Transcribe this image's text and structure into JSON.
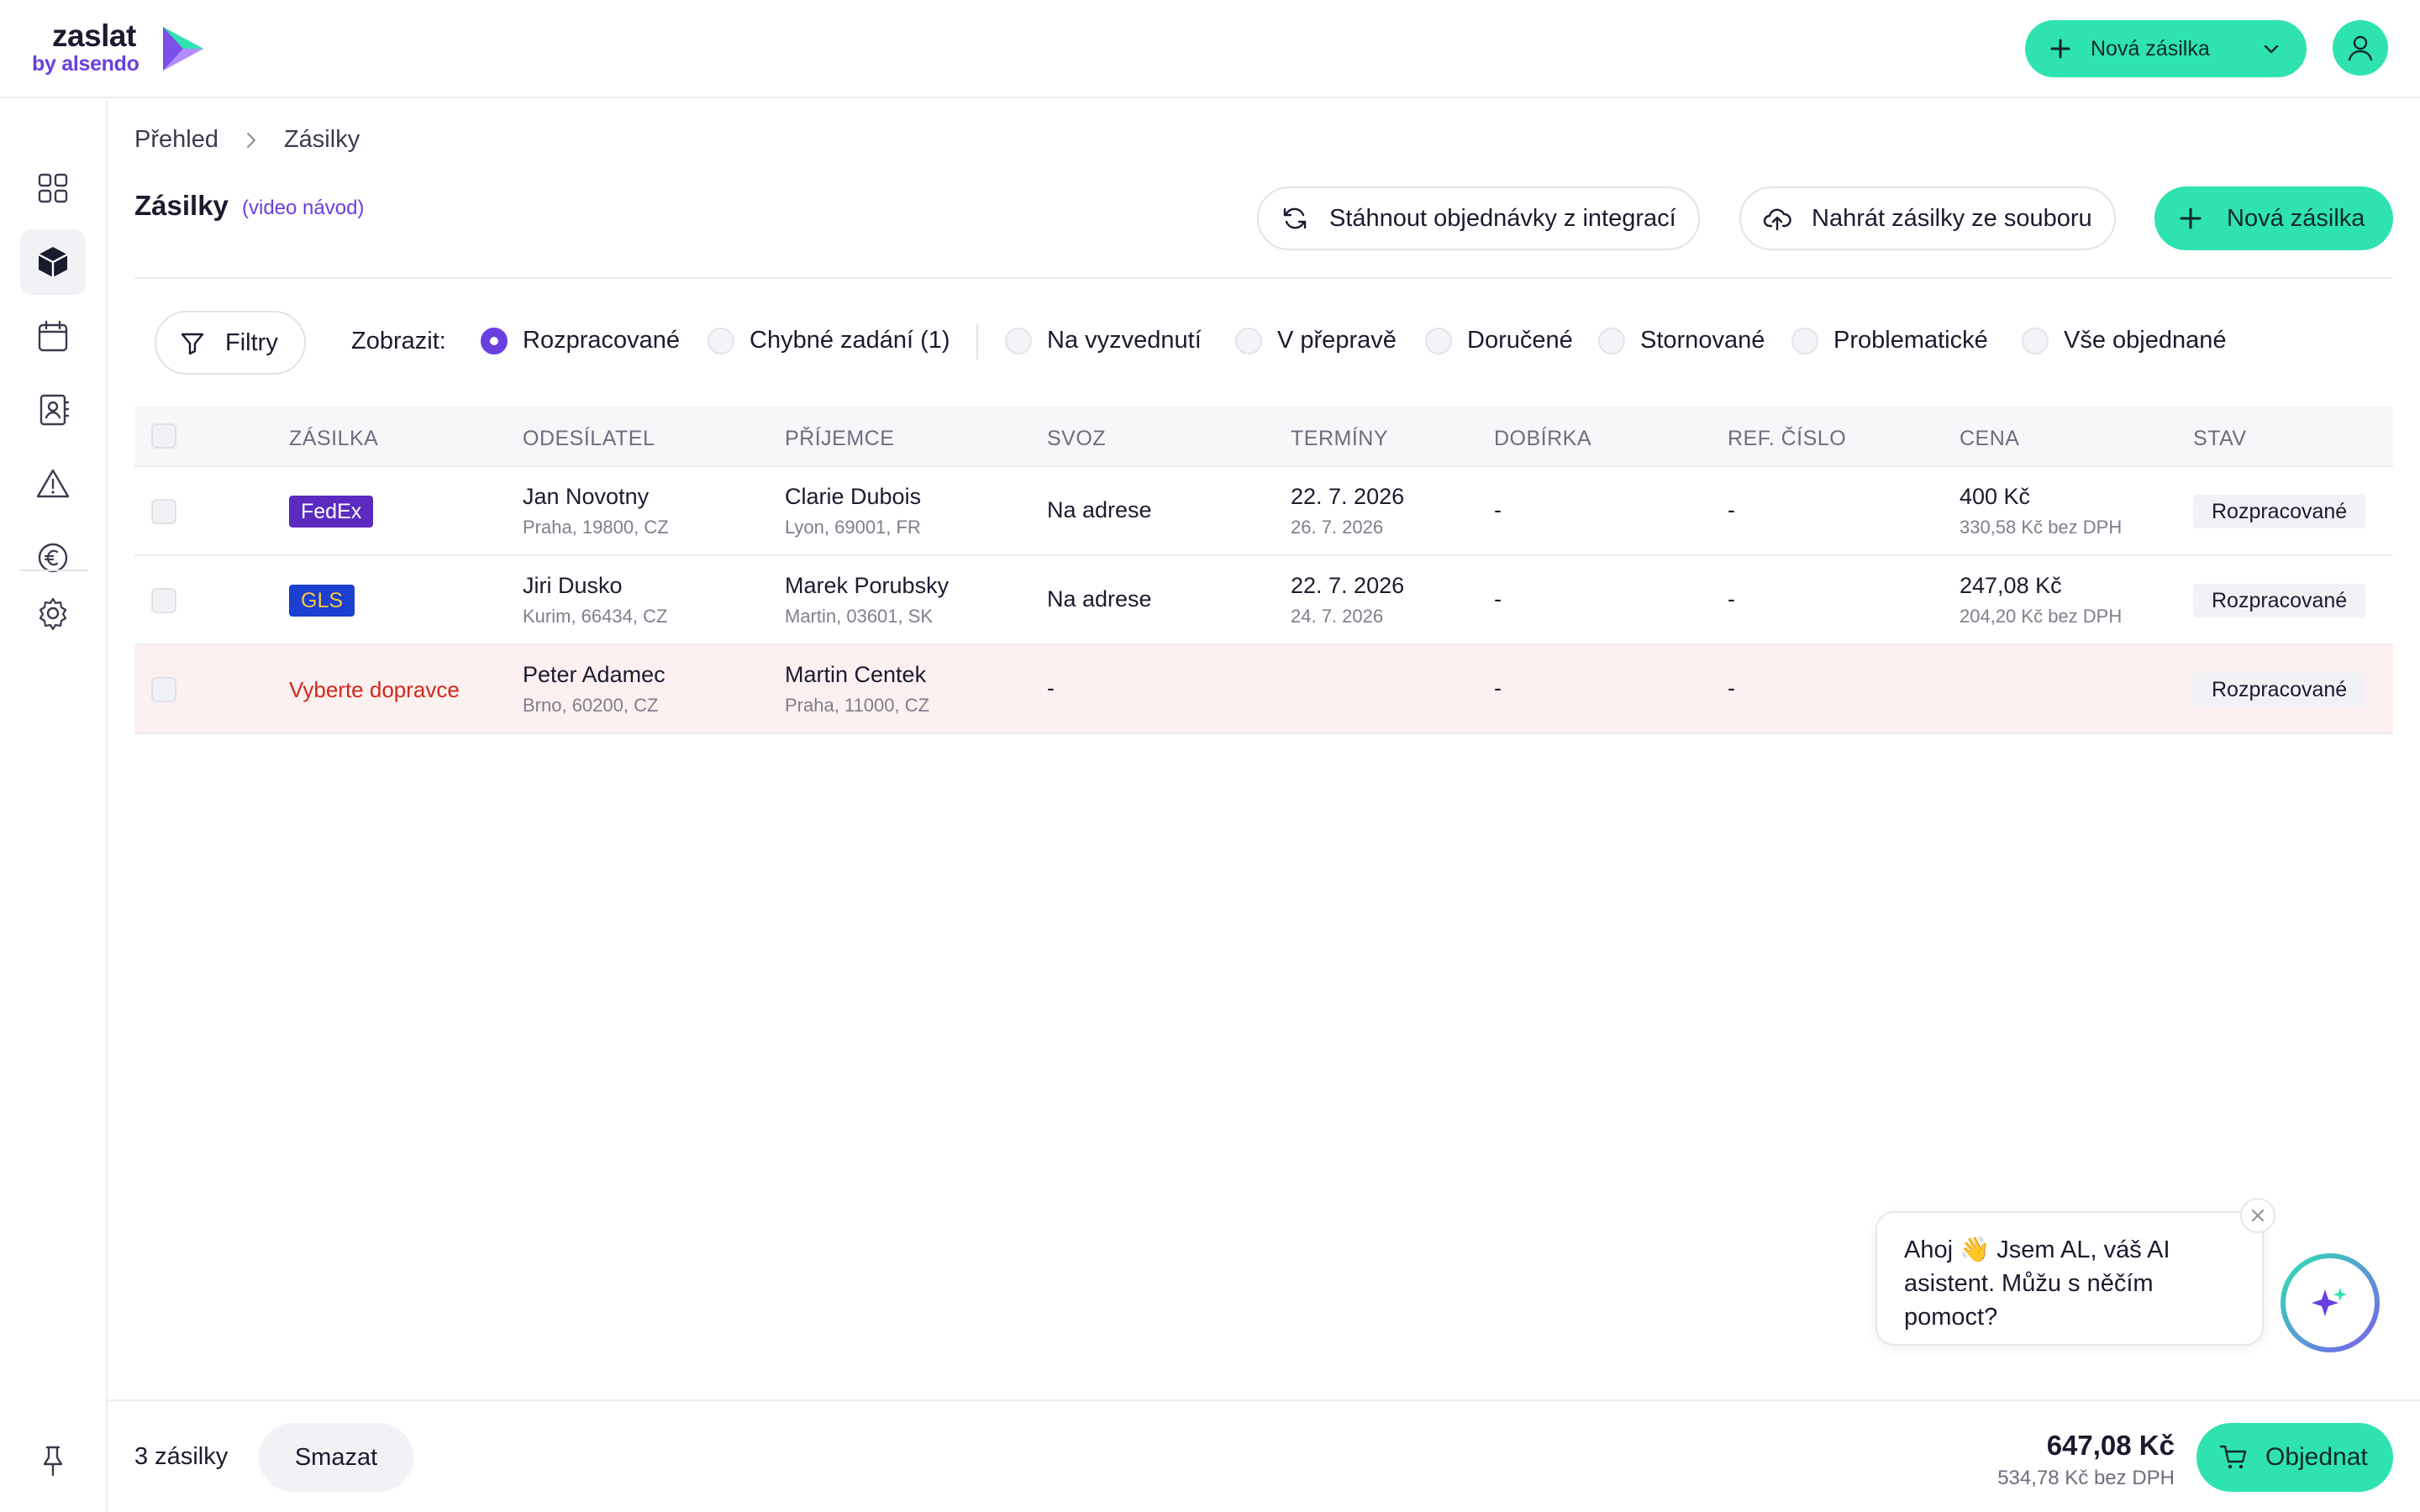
{
  "brand": {
    "name": "zaslat",
    "sub": "by alsendo"
  },
  "header": {
    "new_shipment_label": "Nová zásilka"
  },
  "sidebar": {
    "items": [
      {
        "icon": "grid-icon"
      },
      {
        "icon": "package-icon",
        "active": true
      },
      {
        "icon": "calendar-icon"
      },
      {
        "icon": "contacts-icon"
      },
      {
        "icon": "warning-icon"
      },
      {
        "icon": "euro-icon"
      },
      {
        "icon": "gear-icon"
      }
    ],
    "pin_icon": "pin-icon"
  },
  "breadcrumb": {
    "home": "Přehled",
    "current": "Zásilky"
  },
  "page": {
    "title": "Zásilky",
    "video_link": "(video návod)"
  },
  "actions": {
    "sync_label": "Stáhnout objednávky z integrací",
    "upload_label": "Nahrát zásilky ze souboru",
    "new_label": "Nová zásilka"
  },
  "filters": {
    "button_label": "Filtry",
    "show_label": "Zobrazit:",
    "options": [
      {
        "label": "Rozpracované",
        "checked": true
      },
      {
        "label": "Chybné zadání (1)",
        "checked": false
      },
      {
        "label": "Na vyzvednutí",
        "checked": false
      },
      {
        "label": "V přepravě",
        "checked": false
      },
      {
        "label": "Doručené",
        "checked": false
      },
      {
        "label": "Stornované",
        "checked": false
      },
      {
        "label": "Problematické",
        "checked": false
      },
      {
        "label": "Vše objednané",
        "checked": false
      }
    ]
  },
  "table": {
    "columns": [
      "ZÁSILKA",
      "ODESÍLATEL",
      "PŘÍJEMCE",
      "SVOZ",
      "TERMÍNY",
      "DOBÍRKA",
      "REF. ČÍSLO",
      "CENA",
      "STAV"
    ],
    "rows": [
      {
        "carrier": "FedEx",
        "sender_name": "Jan Novotny",
        "sender_addr": "Praha, 19800, CZ",
        "recipient_name": "Clarie Dubois",
        "recipient_addr": "Lyon, 69001, FR",
        "pickup": "Na adrese",
        "date1": "22. 7. 2026",
        "date2": "26. 7. 2026",
        "cod": "-",
        "ref": "-",
        "price": "400 Kč",
        "price_net": "330,58 Kč bez DPH",
        "status": "Rozpracované"
      },
      {
        "carrier": "GLS",
        "sender_name": "Jiri Dusko",
        "sender_addr": "Kurim, 66434, CZ",
        "recipient_name": "Marek Porubsky",
        "recipient_addr": "Martin, 03601, SK",
        "pickup": "Na adrese",
        "date1": "22. 7. 2026",
        "date2": "24. 7. 2026",
        "cod": "-",
        "ref": "-",
        "price": "247,08 Kč",
        "price_net": "204,20 Kč bez DPH",
        "status": "Rozpracované"
      },
      {
        "carrier": "Vyberte dopravce",
        "sender_name": "Peter Adamec",
        "sender_addr": "Brno, 60200, CZ",
        "recipient_name": "Martin Centek",
        "recipient_addr": "Praha, 11000, CZ",
        "pickup": "-",
        "cod": "-",
        "ref": "-",
        "status": "Rozpracované"
      }
    ]
  },
  "footer": {
    "count": "3 zásilky",
    "delete_label": "Smazat",
    "total": "647,08 Kč",
    "total_net": "534,78 Kč bez DPH",
    "order_label": "Objednat"
  },
  "assistant": {
    "message": "Ahoj 👋 Jsem AL, váš AI asistent. Můžu s něčím pomoct?"
  },
  "colors": {
    "accent": "#2ee3b0",
    "brand": "#6a3fe0",
    "error_row": "#fdf0f0",
    "error_text": "#d2261c"
  }
}
